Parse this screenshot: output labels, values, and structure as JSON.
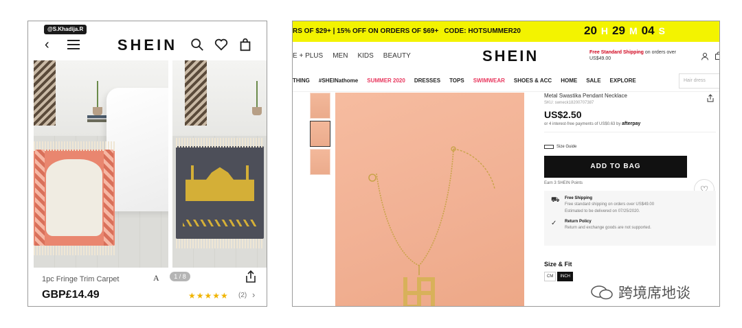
{
  "mobile": {
    "handle": "@S.Khadija.R",
    "logo": "SHEIN",
    "pager": "1 / 8",
    "image_letter": "A",
    "product_title": "1pc Fringe Trim Carpet",
    "price": "GBP£14.49",
    "stars": "★★★★★",
    "rating_count": "(2)",
    "chevron": "›",
    "back_glyph": "‹"
  },
  "desktop": {
    "promo_text": "RS OF $29+  |  15% OFF ON ORDERS OF $69+",
    "promo_code": "CODE: HOTSUMMER20",
    "timer": {
      "h": "20",
      "h_unit": "H",
      "m": "29",
      "m_unit": "M",
      "s": "04",
      "s_unit": "S"
    },
    "top_nav": [
      "E + PLUS",
      "MEN",
      "KIDS",
      "BEAUTY"
    ],
    "logo": "SHEIN",
    "shipping_notice": {
      "highlight": "Free Standard Shipping",
      "rest": " on orders over US$49.00"
    },
    "main_nav": [
      {
        "label": "THING",
        "hot": false
      },
      {
        "label": "#SHEINathome",
        "hot": false
      },
      {
        "label": "SUMMER 2020",
        "hot": true
      },
      {
        "label": "DRESSES",
        "hot": false
      },
      {
        "label": "TOPS",
        "hot": false
      },
      {
        "label": "SWIMWEAR",
        "hot": true
      },
      {
        "label": "SHOES & ACC",
        "hot": false
      },
      {
        "label": "HOME",
        "hot": false
      },
      {
        "label": "SALE",
        "hot": false
      },
      {
        "label": "EXPLORE",
        "hot": false
      }
    ],
    "search_placeholder": "Hair dress",
    "product": {
      "name": "Metal Swastika Pendant Necklace",
      "sku": "SKU: swneck18200707387",
      "price": "US$2.50",
      "afterpay_text": "or 4 interest-free payments of US$0.63 by",
      "afterpay_brand": "afterpay",
      "size_guide": "Size Guide",
      "add_to_bag": "ADD TO BAG",
      "points": "Earn 3 SHEIN Points",
      "free_shipping_title": "Free Shipping",
      "free_shipping_desc": "Free standard shipping on orders over US$49.00",
      "free_shipping_eta": "Estimated to be delivered on 07/25/2020.",
      "return_title": "Return Policy",
      "return_desc": "Return and exchange goods are not supported.",
      "size_fit": "Size & Fit",
      "unit_cm": "CM",
      "unit_inch": "INCH"
    }
  },
  "watermark": "跨境席地谈",
  "colors": {
    "promo_yellow": "#f3f300",
    "hot_pink": "#e8365d",
    "peach_bg": "#f1b093",
    "gold": "#d4af37"
  }
}
